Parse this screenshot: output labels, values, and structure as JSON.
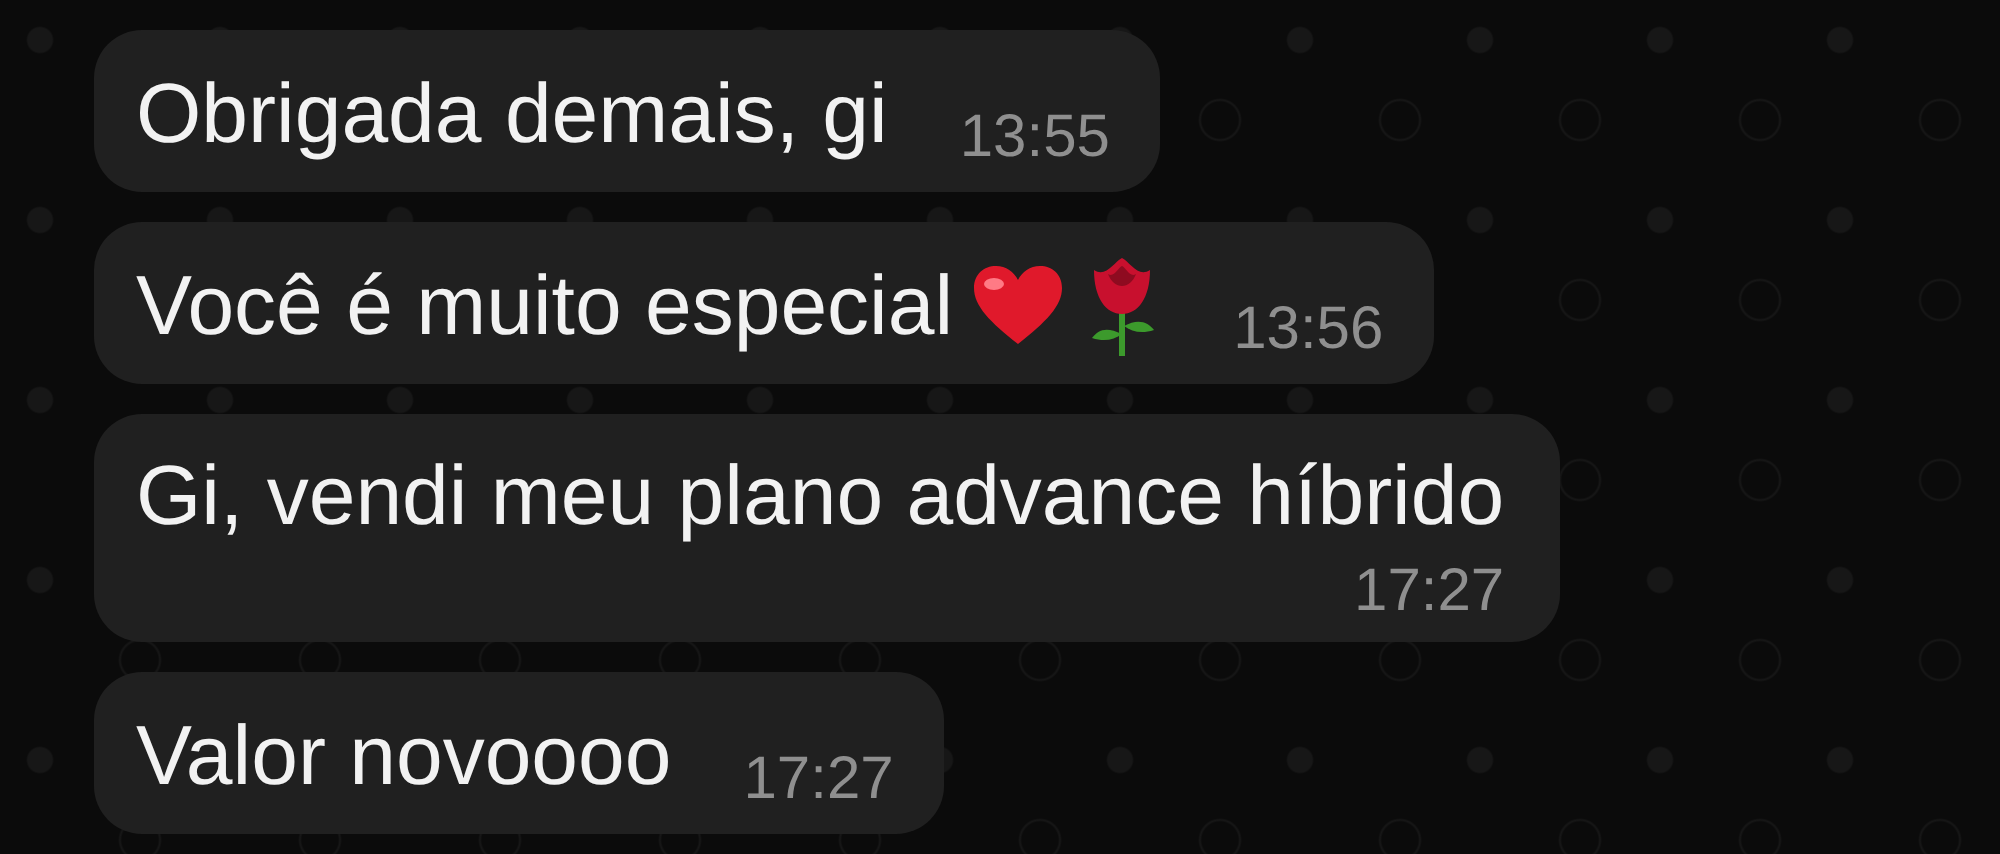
{
  "messages": [
    {
      "kind": "inline",
      "text": "Obrigada demais, gi",
      "time": "13:55"
    },
    {
      "kind": "inline",
      "text": "Você é muito especial",
      "icons": [
        {
          "kind": "heart"
        },
        {
          "kind": "rose"
        }
      ],
      "time": "13:56"
    },
    {
      "kind": "stacked",
      "text": "Gi, vendi meu plano advance híbrido",
      "time": "17:27"
    },
    {
      "kind": "inline",
      "text": "Valor novoooo",
      "time": "17:27"
    }
  ]
}
